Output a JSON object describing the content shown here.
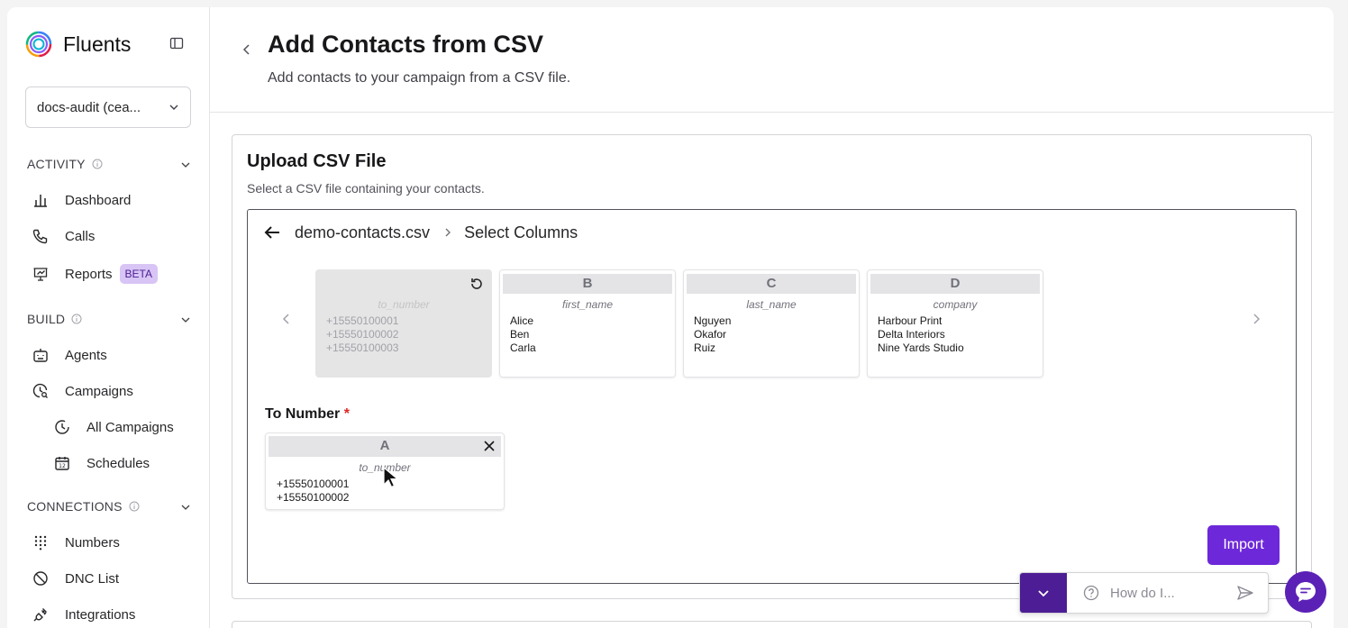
{
  "brand": {
    "name": "Fluents"
  },
  "workspace": {
    "label": "docs-audit (cea..."
  },
  "sidebar": {
    "sections": [
      {
        "label": "ACTIVITY"
      },
      {
        "label": "BUILD"
      },
      {
        "label": "CONNECTIONS"
      }
    ],
    "items": [
      {
        "label": "Dashboard",
        "icon": "bar-chart-icon"
      },
      {
        "label": "Calls",
        "icon": "phone-icon"
      },
      {
        "label": "Reports",
        "icon": "presentation-chart-icon",
        "badge": "BETA"
      },
      {
        "label": "Agents",
        "icon": "robot-icon"
      },
      {
        "label": "Campaigns",
        "icon": "clock-search-icon"
      },
      {
        "label": "All Campaigns",
        "icon": "pie-clock-icon"
      },
      {
        "label": "Schedules",
        "icon": "calendar-icon"
      },
      {
        "label": "Numbers",
        "icon": "dialpad-icon"
      },
      {
        "label": "DNC List",
        "icon": "ban-icon"
      },
      {
        "label": "Integrations",
        "icon": "plug-icon"
      }
    ]
  },
  "header": {
    "title": "Add Contacts from CSV",
    "subtitle": "Add contacts to your campaign from a CSV file."
  },
  "upload": {
    "title": "Upload CSV File",
    "subtitle": "Select a CSV file containing your contacts.",
    "file_name": "demo-contacts.csv",
    "step": "Select Columns",
    "columns": [
      {
        "letter": "A",
        "header": "to_number",
        "values": [
          "+15550100001",
          "+15550100002",
          "+15550100003"
        ],
        "used": true
      },
      {
        "letter": "B",
        "header": "first_name",
        "values": [
          "Alice",
          "Ben",
          "Carla"
        ],
        "used": false
      },
      {
        "letter": "C",
        "header": "last_name",
        "values": [
          "Nguyen",
          "Okafor",
          "Ruiz"
        ],
        "used": false
      },
      {
        "letter": "D",
        "header": "company",
        "values": [
          "Harbour Print",
          "Delta Interiors",
          "Nine Yards Studio"
        ],
        "used": false
      }
    ],
    "field": {
      "label": "To Number",
      "required_mark": "*",
      "letter": "A",
      "header": "to_number",
      "values": [
        "+15550100001",
        "+15550100002"
      ]
    },
    "import_label": "Import"
  },
  "help": {
    "placeholder": "How do I..."
  },
  "colors": {
    "accent": "#6d28d9",
    "accent_dark": "#4c1d95",
    "beta_bg": "#d8c5f5"
  }
}
